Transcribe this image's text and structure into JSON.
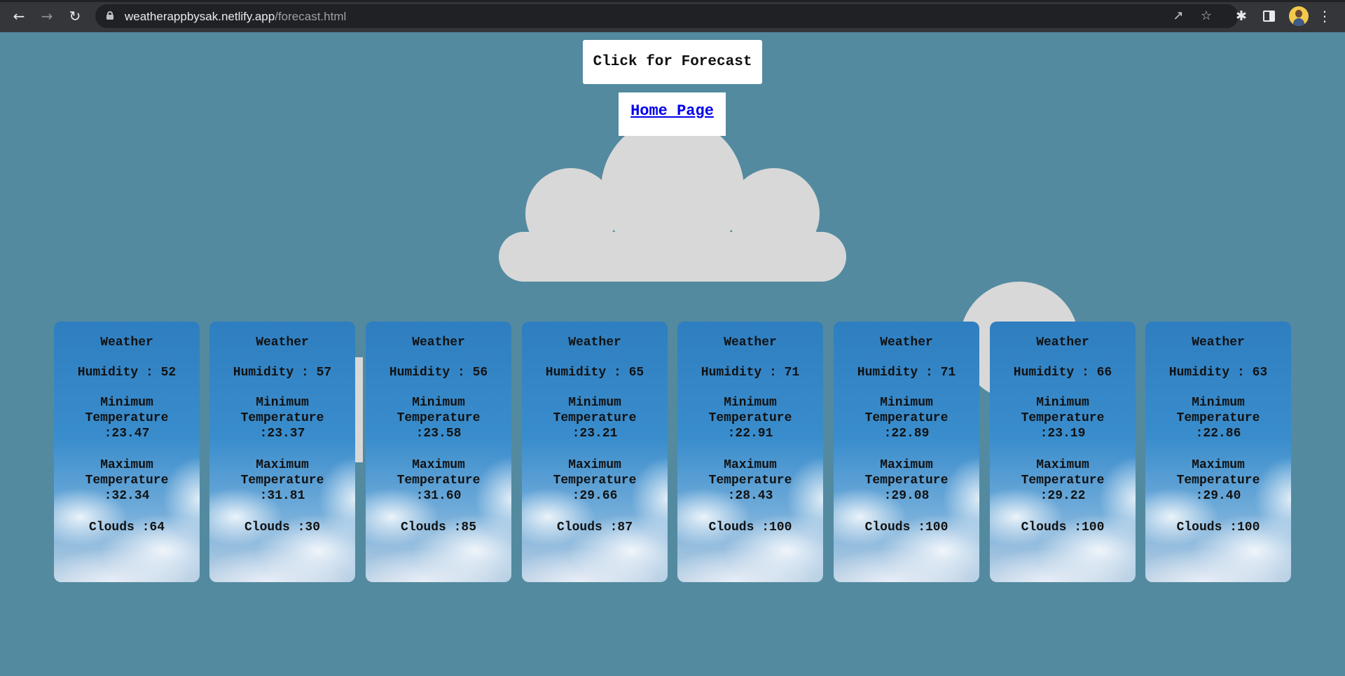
{
  "browser": {
    "url_domain": "weatherappbysak.netlify.app",
    "url_path": "/forecast.html",
    "icons": [
      "back-arrow-icon",
      "forward-arrow-icon",
      "reload-icon",
      "lock-icon",
      "share-icon",
      "star-icon",
      "extensions-icon",
      "side-panel-icon",
      "avatar",
      "kebab-menu-icon"
    ]
  },
  "page": {
    "forecast_button": "Click for Forecast",
    "home_link": "Home Page",
    "background_color": "#538aa0"
  },
  "cards": [
    {
      "title": "Weather",
      "humidity_label": "Humidity : 52",
      "min_label": "Minimum",
      "min_sub": "Temperature",
      "min_value": ":23.47",
      "max_label": "Maximum",
      "max_sub": "Temperature",
      "max_value": ":32.34",
      "clouds": "Clouds :64"
    },
    {
      "title": "Weather",
      "humidity_label": "Humidity : 57",
      "min_label": "Minimum",
      "min_sub": "Temperature",
      "min_value": ":23.37",
      "max_label": "Maximum",
      "max_sub": "Temperature",
      "max_value": ":31.81",
      "clouds": "Clouds :30"
    },
    {
      "title": "Weather",
      "humidity_label": "Humidity : 56",
      "min_label": "Minimum",
      "min_sub": "Temperature",
      "min_value": ":23.58",
      "max_label": "Maximum",
      "max_sub": "Temperature",
      "max_value": ":31.60",
      "clouds": "Clouds :85"
    },
    {
      "title": "Weather",
      "humidity_label": "Humidity : 65",
      "min_label": "Minimum",
      "min_sub": "Temperature",
      "min_value": ":23.21",
      "max_label": "Maximum",
      "max_sub": "Temperature",
      "max_value": ":29.66",
      "clouds": "Clouds :87"
    },
    {
      "title": "Weather",
      "humidity_label": "Humidity : 71",
      "min_label": "Minimum",
      "min_sub": "Temperature",
      "min_value": ":22.91",
      "max_label": "Maximum",
      "max_sub": "Temperature",
      "max_value": ":28.43",
      "clouds": "Clouds :100"
    },
    {
      "title": "Weather",
      "humidity_label": "Humidity : 71",
      "min_label": "Minimum",
      "min_sub": "Temperature",
      "min_value": ":22.89",
      "max_label": "Maximum",
      "max_sub": "Temperature",
      "max_value": ":29.08",
      "clouds": "Clouds :100"
    },
    {
      "title": "Weather",
      "humidity_label": "Humidity : 66",
      "min_label": "Minimum",
      "min_sub": "Temperature",
      "min_value": ":23.19",
      "max_label": "Maximum",
      "max_sub": "Temperature",
      "max_value": ":29.22",
      "clouds": "Clouds :100"
    },
    {
      "title": "Weather",
      "humidity_label": "Humidity : 63",
      "min_label": "Minimum",
      "min_sub": "Temperature",
      "min_value": ":22.86",
      "max_label": "Maximum",
      "max_sub": "Temperature",
      "max_value": ":29.40",
      "clouds": "Clouds :100"
    }
  ]
}
